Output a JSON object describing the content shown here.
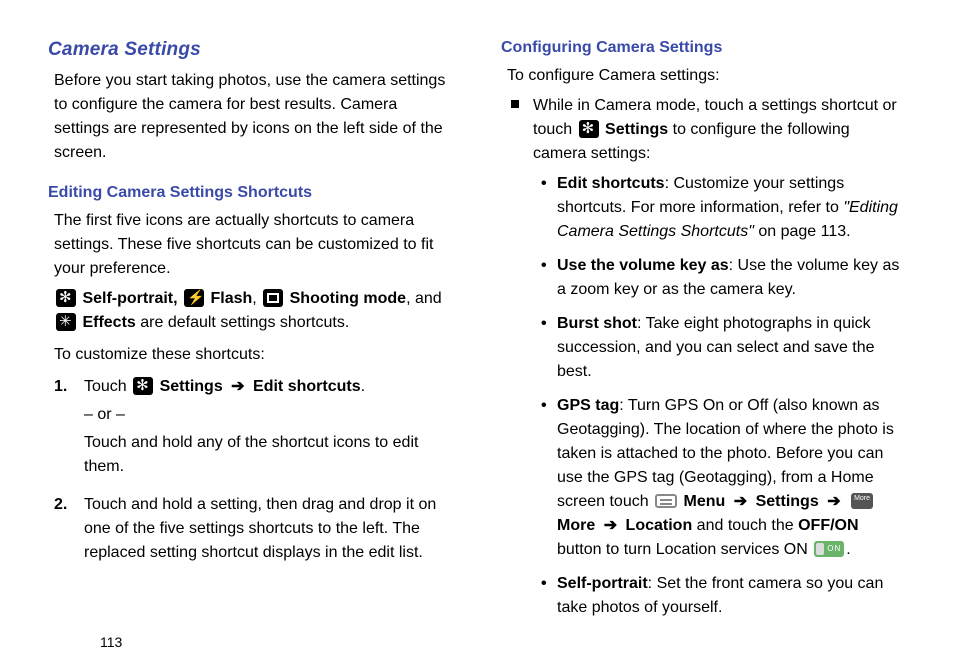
{
  "page_number": "113",
  "left": {
    "section_title": "Camera Settings",
    "intro": "Before you start taking photos, use the camera settings to configure the camera for best results. Camera settings are represented by icons on the left side of the screen.",
    "sub1_title": "Editing Camera Settings Shortcuts",
    "sub1_para": "The first five icons are actually shortcuts to camera settings. These five shortcuts can be customized to fit your preference.",
    "shortcut_line_parts": {
      "selfportrait": "Self-portrait,",
      "flash": "Flash",
      "shooting": "Shooting mode",
      "and": ", and",
      "effects": "Effects",
      "tail": " are default settings shortcuts."
    },
    "customize_lead": "To customize these shortcuts:",
    "step1_touch": "Touch ",
    "step1_settings": "Settings",
    "step1_arrow": " ➔ ",
    "step1_edit": "Edit shortcuts",
    "step1_period": ".",
    "step1_or": "– or –",
    "step1_hold": "Touch and hold any of the shortcut icons to edit them.",
    "step2": "Touch and hold a setting, then drag and drop it on one of the five settings shortcuts to the left. The replaced setting shortcut displays in the edit list."
  },
  "right": {
    "sub2_title": "Configuring Camera Settings",
    "sub2_lead": "To configure Camera settings:",
    "square_item_pre": "While in Camera mode, touch a settings shortcut or touch ",
    "square_item_settings": "Settings",
    "square_item_post": " to configure the following camera settings:",
    "b_edit_title": "Edit shortcuts",
    "b_edit_body": ": Customize your settings shortcuts. For more information, refer to ",
    "b_edit_ref": "\"Editing Camera Settings Shortcuts\"",
    "b_edit_page": "  on page 113.",
    "b_vol_title": "Use the volume key as",
    "b_vol_body": ": Use the volume key as a zoom key or as the camera key.",
    "b_burst_title": "Burst shot",
    "b_burst_body": ": Take eight photographs in quick succession, and you can select and save the best.",
    "b_gps_title": "GPS tag",
    "b_gps_body1": ": Turn GPS On or Off (also known as Geotagging). The location of where the photo is taken is attached to the photo. Before you can use the GPS tag (Geotagging), from a Home screen touch ",
    "b_gps_menu": "Menu",
    "b_gps_arrow": " ➔ ",
    "b_gps_settings": "Settings",
    "b_gps_more": "More",
    "b_gps_location": "Location",
    "b_gps_tail": " and touch the ",
    "b_gps_offon": "OFF/ON",
    "b_gps_tail2": " button to turn Location services ON ",
    "b_gps_period": ".",
    "b_self_title": "Self-portrait",
    "b_self_body": ": Set the front camera so you can take photos of yourself."
  }
}
